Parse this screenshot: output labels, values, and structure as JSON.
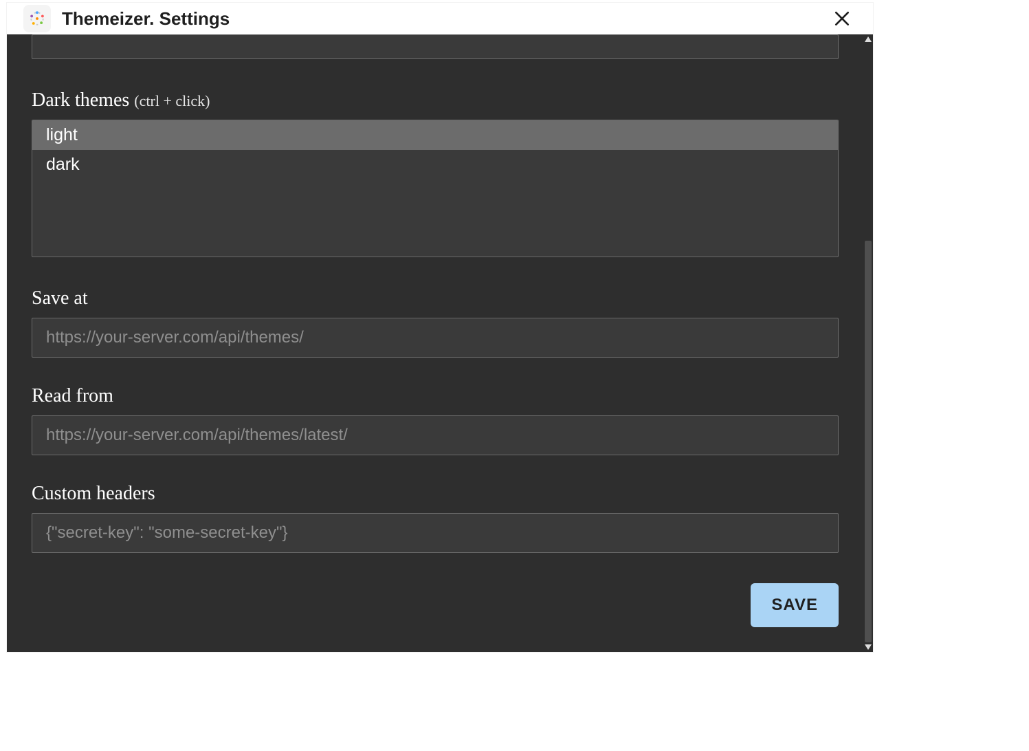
{
  "header": {
    "title": "Themeizer. Settings"
  },
  "form": {
    "dark_themes": {
      "label": "Dark themes",
      "hint": "(ctrl + click)",
      "options": [
        "light",
        "dark"
      ],
      "selected": "light"
    },
    "save_at": {
      "label": "Save at",
      "placeholder": "https://your-server.com/api/themes/",
      "value": ""
    },
    "read_from": {
      "label": "Read from",
      "placeholder": "https://your-server.com/api/themes/latest/",
      "value": ""
    },
    "custom_headers": {
      "label": "Custom headers",
      "placeholder": "{\"secret-key\": \"some-secret-key\"}",
      "value": ""
    }
  },
  "actions": {
    "save_label": "SAVE"
  },
  "colors": {
    "background_dark": "#2e2e2e",
    "input_fill": "#3a3a3a",
    "input_border": "#6a6a6a",
    "option_selected": "#6c6c6c",
    "save_button": "#aad4f5"
  }
}
